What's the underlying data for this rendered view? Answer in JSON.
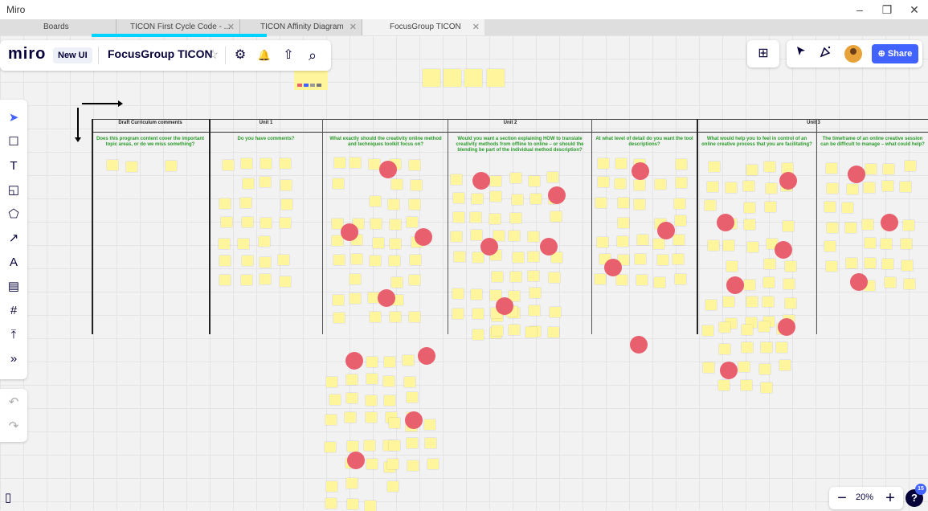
{
  "window": {
    "app_title": "Miro",
    "minimize": "–",
    "maximize": "❐",
    "close": "✕"
  },
  "tabs": [
    {
      "label": "Boards"
    },
    {
      "label": "TICON First Cycle Code - ...",
      "close": "✕"
    },
    {
      "label": "TICON Affinity Diagram",
      "close": "✕"
    },
    {
      "label": "FocusGroup TICON",
      "close": "✕"
    }
  ],
  "toolbar": {
    "logo": "miro",
    "new_ui_label": "New UI",
    "board_name": "FocusGroup TICON",
    "star_icon": "☆",
    "settings_icon": "⚙",
    "bell_icon": "🔔",
    "upload_icon": "⇧",
    "search_icon": "⌕"
  },
  "right_toolbar": {
    "apps_icon": "⊞",
    "share_label": "⊕ Share"
  },
  "left_tools": [
    "select-icon",
    "frames-icon",
    "text-icon",
    "sticky-note-icon",
    "shapes-icon",
    "connector-icon",
    "pen-icon",
    "comment-icon",
    "frame-icon",
    "upload-icon",
    "more-icon"
  ],
  "left_tool_glyphs": [
    "➤",
    "☐",
    "T",
    "◱",
    "⬠",
    "↗",
    "A",
    "▤",
    "#",
    "⤒",
    "»"
  ],
  "undo_glyph": "↶",
  "redo_glyph": "↷",
  "panel_glyph": "▯",
  "zoom": {
    "minus": "−",
    "value": "20%",
    "plus": "+"
  },
  "help": {
    "glyph": "?",
    "badge": "15"
  },
  "board": {
    "col_heads": [
      {
        "label": "Draft Curriculum comments"
      },
      {
        "label": "Unit 1"
      },
      {
        "label": "Unit 2"
      },
      {
        "label": "Unit 3"
      }
    ],
    "questions": [
      "Does this program content cover the important topic areas, or do we miss something?",
      "Do you have comments?",
      "What exactly should the creativity online method and techniques toolkit focus on?",
      "Would you want a section explaining HOW to translate creativity methods from offline to online – or should the blending be part of the individual method description?",
      "At what level of detail do you want the tool descriptions?",
      "What would help you to feel in control of an online creative process that you are facilitating?",
      "The timeframe of an online creative session can be difficult to manage – what could help?"
    ]
  },
  "colors": {
    "accent": "#4262ff",
    "sticky": "#fff59c",
    "dot": "#e8606e",
    "question": "#2a9a2a",
    "loading": "#00d4ff"
  }
}
